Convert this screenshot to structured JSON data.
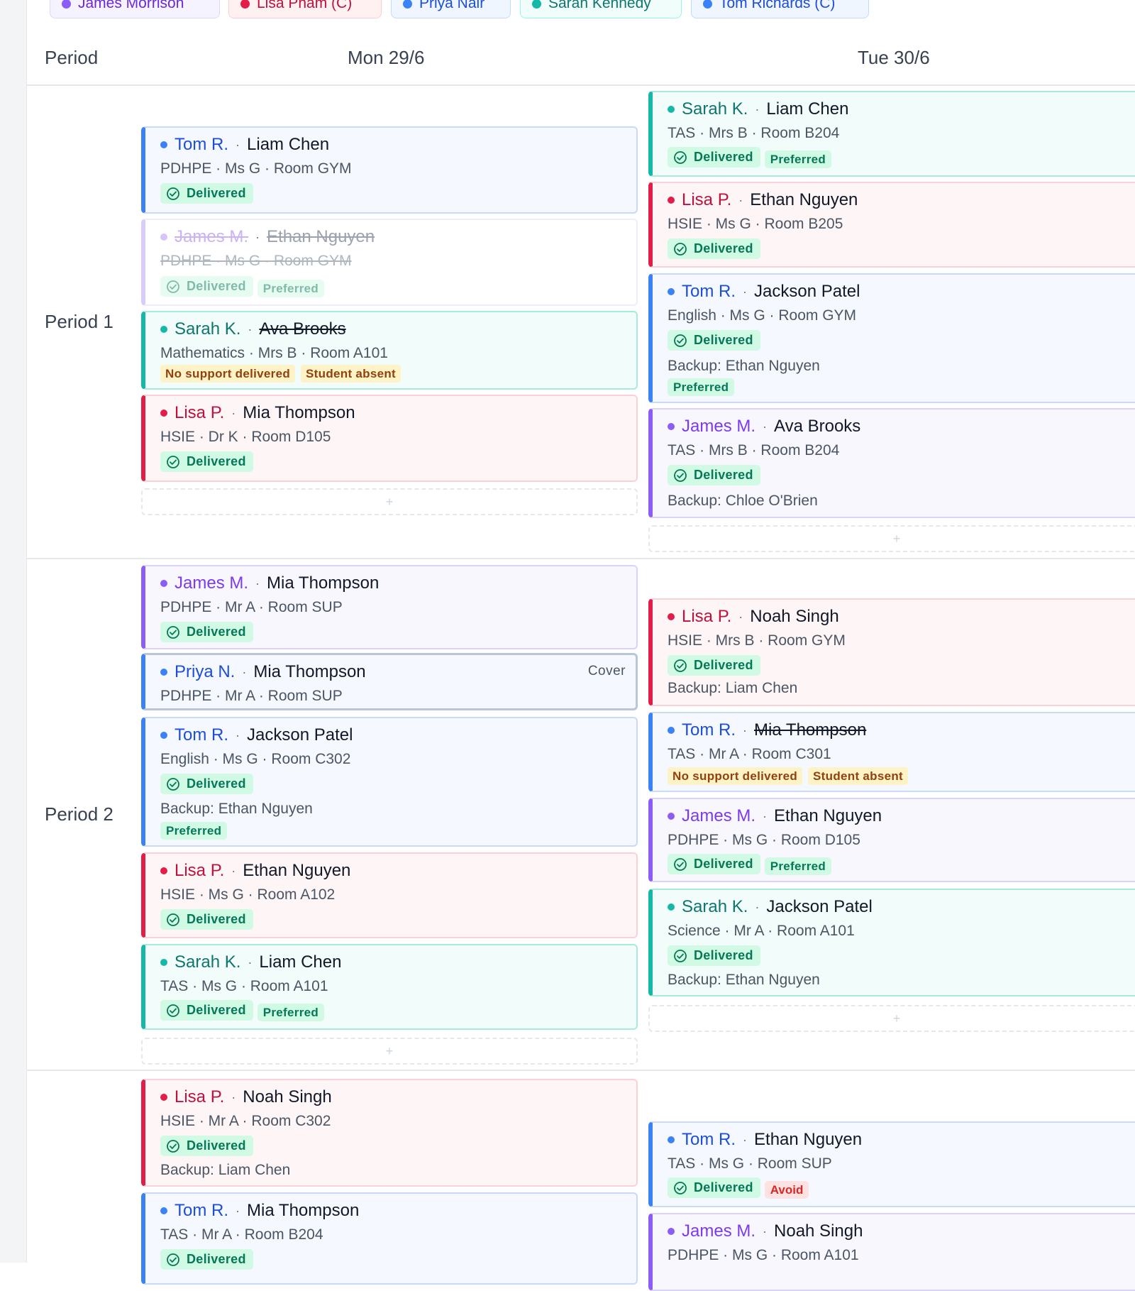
{
  "legend": [
    {
      "label": "James Morrison",
      "color": "purple"
    },
    {
      "label": "Lisa Pham (C)",
      "color": "red"
    },
    {
      "label": "Priya Nair",
      "color": "blue"
    },
    {
      "label": "Sarah Kennedy",
      "color": "teal"
    },
    {
      "label": "Tom Richards (C)",
      "color": "blue"
    }
  ],
  "header": {
    "period": "Period",
    "day1": "Mon 29/6",
    "day2": "Tue 30/6"
  },
  "periods": {
    "p1": "Period 1",
    "p2": "Period 2"
  },
  "common": {
    "dot_sep": "·",
    "delivered": "Delivered",
    "preferred": "Preferred",
    "no_support": "No support delivered",
    "student_absent": "Student absent",
    "avoid": "Avoid",
    "cover": "Cover",
    "add": "+"
  },
  "colors": {
    "purple": "#8b5cf6",
    "red": "#e11d48",
    "blue": "#3b82f6",
    "teal": "#14b8a6",
    "delivered_bg": "#d1fae5",
    "delivered_fg": "#047857"
  },
  "cards": {
    "m1a": {
      "teacher": "Tom R.",
      "student": "Liam Chen",
      "details": "PDHPE · Ms G · Room GYM"
    },
    "m1b": {
      "teacher": "James M.",
      "student": "Ethan Nguyen",
      "details": "PDHPE · Ms G · Room GYM"
    },
    "m1c": {
      "teacher": "Sarah K.",
      "student": "Ava Brooks",
      "details": "Mathematics · Mrs B · Room A101"
    },
    "m1d": {
      "teacher": "Lisa P.",
      "student": "Mia Thompson",
      "details": "HSIE · Dr K · Room D105"
    },
    "t1a": {
      "teacher": "Sarah K.",
      "student": "Liam Chen",
      "details": "TAS · Mrs B · Room B204"
    },
    "t1b": {
      "teacher": "Lisa P.",
      "student": "Ethan Nguyen",
      "details": "HSIE · Ms G · Room B205"
    },
    "t1c": {
      "teacher": "Tom R.",
      "student": "Jackson Patel",
      "details": "English · Ms G · Room GYM",
      "backup": "Backup: Ethan Nguyen"
    },
    "t1d": {
      "teacher": "James M.",
      "student": "Ava Brooks",
      "details": "TAS · Mrs B · Room B204",
      "backup": "Backup: Chloe O'Brien"
    },
    "m2a": {
      "teacher": "James M.",
      "student": "Mia Thompson",
      "details": "PDHPE · Mr A · Room SUP"
    },
    "m2b": {
      "teacher": "Priya N.",
      "student": "Mia Thompson",
      "details": "PDHPE · Mr A · Room SUP"
    },
    "m2c": {
      "teacher": "Tom R.",
      "student": "Jackson Patel",
      "details": "English · Ms G · Room C302",
      "backup": "Backup: Ethan Nguyen"
    },
    "m2d": {
      "teacher": "Lisa P.",
      "student": "Ethan Nguyen",
      "details": "HSIE · Ms G · Room A102"
    },
    "m2e": {
      "teacher": "Sarah K.",
      "student": "Liam Chen",
      "details": "TAS · Ms G · Room A101"
    },
    "t2a": {
      "teacher": "Lisa P.",
      "student": "Noah Singh",
      "details": "HSIE · Mrs B · Room GYM",
      "backup": "Backup: Liam Chen"
    },
    "t2b": {
      "teacher": "Tom R.",
      "student": "Mia Thompson",
      "details": "TAS · Mr A · Room C301"
    },
    "t2c": {
      "teacher": "James M.",
      "student": "Ethan Nguyen",
      "details": "PDHPE · Ms G · Room D105"
    },
    "t2d": {
      "teacher": "Sarah K.",
      "student": "Jackson Patel",
      "details": "Science · Mr A · Room A101",
      "backup": "Backup: Ethan Nguyen"
    },
    "m3a": {
      "teacher": "Lisa P.",
      "student": "Noah Singh",
      "details": "HSIE · Mr A · Room C302",
      "backup": "Backup: Liam Chen"
    },
    "m3b": {
      "teacher": "Tom R.",
      "student": "Mia Thompson",
      "details": "TAS · Mr A · Room B204"
    },
    "t3a": {
      "teacher": "Tom R.",
      "student": "Ethan Nguyen",
      "details": "TAS · Ms G · Room SUP"
    },
    "t3b": {
      "teacher": "James M.",
      "student": "Noah Singh",
      "details": "PDHPE · Ms G · Room A101"
    }
  }
}
